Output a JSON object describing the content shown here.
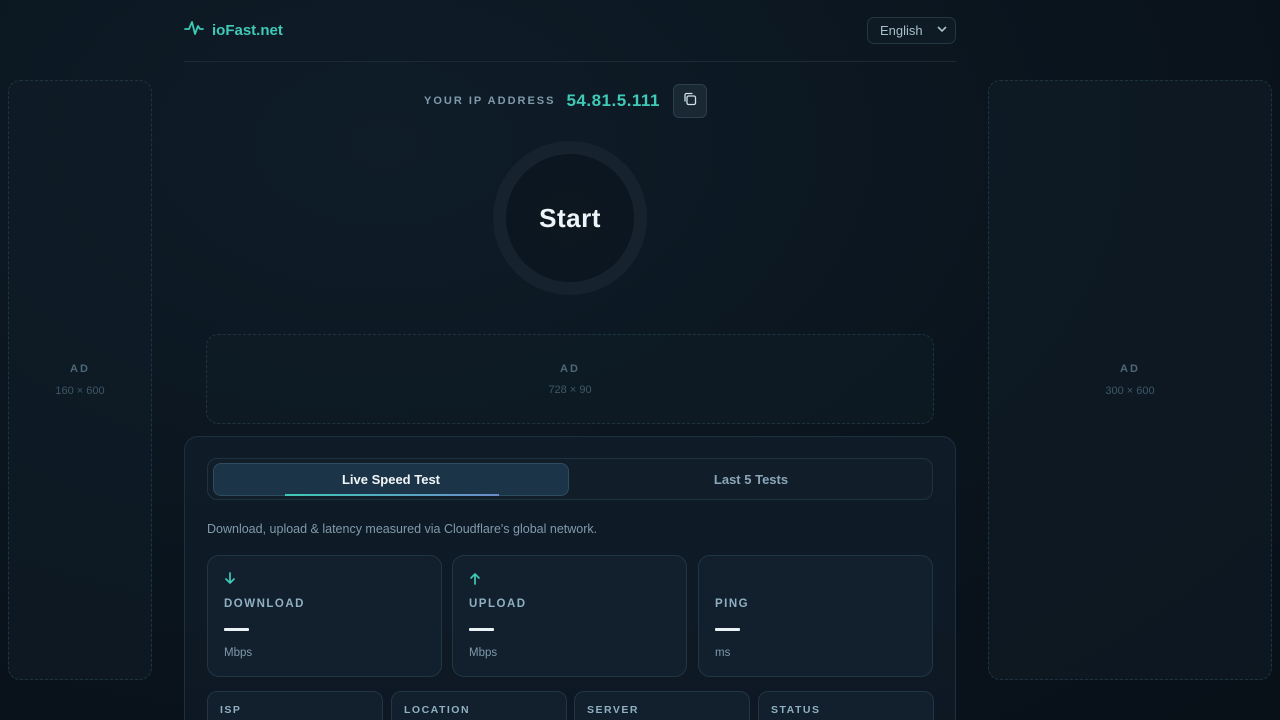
{
  "brand": {
    "name": "ioFast.net",
    "icon": "pulse-icon"
  },
  "language": {
    "selected": "English"
  },
  "ads": {
    "left": {
      "label": "AD",
      "size": "160 × 600"
    },
    "right": {
      "label": "AD",
      "size": "300 × 600"
    },
    "banner": {
      "label": "AD",
      "size": "728 × 90"
    }
  },
  "ip": {
    "label": "YOUR IP ADDRESS",
    "value": "54.81.5.111",
    "copy_icon": "copy-icon"
  },
  "start": {
    "label": "Start"
  },
  "tabs": [
    {
      "label": "Live Speed Test",
      "active": true
    },
    {
      "label": "Last 5 Tests",
      "active": false
    }
  ],
  "description": "Download, upload & latency measured via Cloudflare's global network.",
  "metrics": [
    {
      "label": "DOWNLOAD",
      "unit": "Mbps",
      "icon": "arrow-down-icon"
    },
    {
      "label": "UPLOAD",
      "unit": "Mbps",
      "icon": "arrow-up-icon"
    },
    {
      "label": "PING",
      "unit": "ms",
      "icon": ""
    }
  ],
  "info_cards": [
    {
      "label": "ISP"
    },
    {
      "label": "LOCATION"
    },
    {
      "label": "SERVER"
    },
    {
      "label": "STATUS"
    }
  ],
  "colors": {
    "accent": "#3fc9b6",
    "background": "#0a141d",
    "panel": "#0f1c28"
  }
}
